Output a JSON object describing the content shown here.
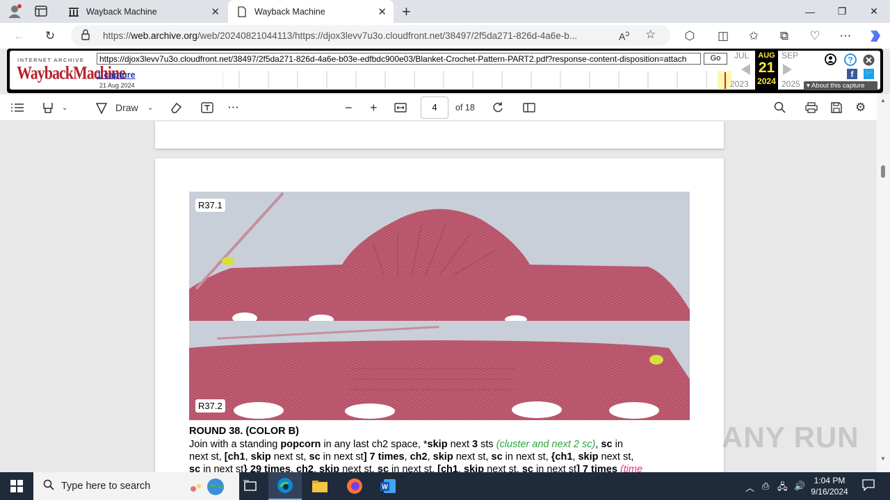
{
  "browser": {
    "tabs": [
      {
        "title": "Wayback Machine"
      },
      {
        "title": "Wayback Machine"
      }
    ],
    "address": {
      "prefix": "https://",
      "domain": "web.archive.org",
      "rest": "/web/20240821044113/https://djox3levv7u3o.cloudfront.net/38497/2f5da271-826d-4a6e-b..."
    }
  },
  "wayback": {
    "logo_top": "INTERNET ARCHIVE",
    "logo": "WaybackMachine",
    "url_input": "https://djox3levv7u3o.cloudfront.net/38497/2f5da271-826d-4a6e-b03e-edfbdc900e03/Blanket-Crochet-Pattern-PART2.pdf?response-content-disposition=attach",
    "go_label": "Go",
    "capture_link": "1 capture",
    "capture_date": "21 Aug 2024",
    "prev_month": "JUL",
    "cur_month": "AUG",
    "cur_day": "21",
    "next_month": "SEP",
    "prev_year": "2023",
    "cur_year": "2024",
    "next_year": "2025",
    "about": "About this capture"
  },
  "pdf": {
    "draw_label": "Draw",
    "page_number": "4",
    "page_total": "of 18",
    "photo_labels": [
      "R37.1",
      "R37.2"
    ],
    "round_title": "ROUND 38. (COLOR B)",
    "lines": [
      [
        "Join with a standing ",
        "popcorn",
        " in any last ch2 space, *",
        "skip",
        " next ",
        "3",
        " sts ",
        "(cluster and next 2 sc)",
        ", ",
        "sc",
        " in"
      ],
      [
        "next st, ",
        "[ch1",
        ", ",
        "skip",
        " next st, ",
        "sc",
        " in next st",
        "] 7 times",
        ", ",
        "ch2",
        ", ",
        "skip",
        " next st, ",
        "sc",
        " in next st, ",
        "{ch1",
        ", ",
        "skip",
        " next st,"
      ],
      [
        "sc",
        " in next st",
        "} 29 times",
        ", ",
        "ch2",
        ", ",
        "skip",
        " next st, ",
        "sc",
        " in next st, ",
        "[ch1",
        ", ",
        "skip",
        " next st, ",
        "sc",
        " in next st",
        "] 7 times",
        " ",
        "(time"
      ]
    ]
  },
  "watermark": "ANY RUN",
  "taskbar": {
    "search_placeholder": "Type here to search",
    "time": "1:04 PM",
    "date": "9/16/2024"
  },
  "colors": {
    "wayback_red": "#b6232d",
    "wayback_yellow": "#ffeb3b",
    "taskbar_bg": "#1f2b3a",
    "yarn_pink": "#c05a72"
  }
}
